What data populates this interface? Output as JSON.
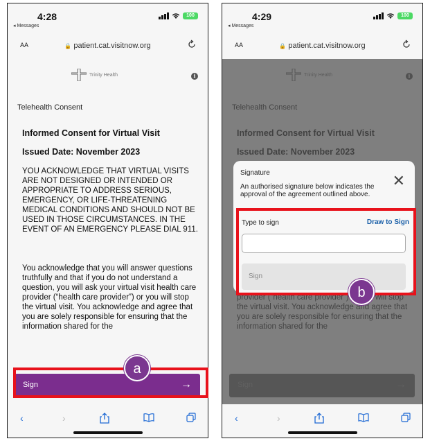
{
  "shared": {
    "back_label": "◂ Messages",
    "aa": "AA",
    "url": "patient.cat.visitnow.org",
    "logo_text": "Trinity Health",
    "consent_label": "Telehealth Consent",
    "title1": "Informed Consent for Virtual Visit",
    "title2": "Issued Date: November 2023",
    "para1": "YOU ACKNOWLEDGE THAT VIRTUAL VISITS ARE NOT DESIGNED OR INTENDED OR APPROPRIATE TO ADDRESS SERIOUS, EMERGENCY, OR LIFE-THREATENING MEDICAL CONDITIONS AND SHOULD NOT BE USED IN THOSE CIRCUMSTANCES. IN THE EVENT OF AN EMERGENCY PLEASE DIAL 911.",
    "para2": "You acknowledge that you will answer questions truthfully and that if you do not understand a question, you will ask your virtual visit health care provider (“health care provider”) or you will stop the virtual visit. You acknowledge and agree that you are solely responsible for ensuring that the information shared for the",
    "sign_label": "Sign",
    "sign_arrow": "→",
    "battery": "100"
  },
  "screenA": {
    "time": "4:28",
    "badge": "a"
  },
  "screenB": {
    "time": "4:29",
    "badge": "b",
    "modal": {
      "title": "Signature",
      "close": "✕",
      "description": "An authorised signature below indicates the approval of the agreement outlined above.",
      "type_label": "Type to sign",
      "draw_link": "Draw to Sign",
      "input_value": "",
      "sign_button": "Sign"
    }
  },
  "toolbar": {
    "back": "‹",
    "forward": "›",
    "share": "⇧",
    "bookmarks": "📖",
    "tabs": "⧉"
  },
  "colors": {
    "accent": "#7b2d8e",
    "highlight": "#e8121b",
    "badge": "#7b3790",
    "link": "#1a5fa8"
  }
}
